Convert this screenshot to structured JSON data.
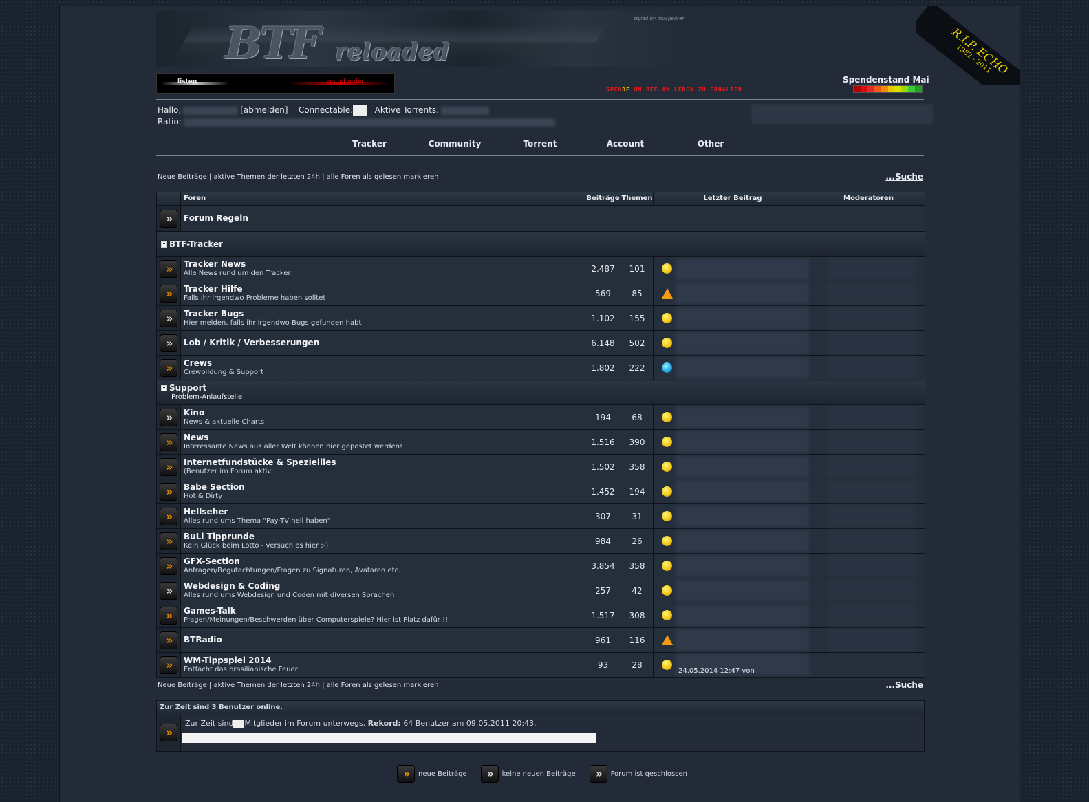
{
  "header": {
    "logo": "BTF",
    "logo_sub": "reloaded",
    "styled_by": "styled by m03pedren",
    "rip": {
      "line1": "R.I.P. ECHO",
      "line2": "1982 - 2011"
    },
    "radio": {
      "listen": "listen",
      "status": "out of order"
    },
    "spende": {
      "part1": "SPEN",
      "part2": "DE",
      "part3": " UM BTF AM LEBEN ZU ERHALTEN"
    },
    "spendenstand": "Spendenstand Mai",
    "spend_colors": [
      "#b40000",
      "#d21010",
      "#e62828",
      "#ee5a1a",
      "#f08c10",
      "#e8c800",
      "#d6e000",
      "#9ad800",
      "#3cc83c",
      "#20a020"
    ]
  },
  "user": {
    "hallo": "Hallo,",
    "abmelden": "[abmelden]",
    "connectable": "Connectable:",
    "aktive_torrents": "Aktive Torrents:",
    "ratio": "Ratio:"
  },
  "nav": [
    "Tracker",
    "Community",
    "Torrent",
    "Account",
    "Other"
  ],
  "links": {
    "neue": "Neue Beiträge",
    "sep": " | ",
    "aktive": "aktive Themen der letzten 24h",
    "alle": "alle Foren als gelesen markieren",
    "suche": "...Suche"
  },
  "table": {
    "headers": {
      "foren": "Foren",
      "beitraege": "Beiträge",
      "themen": "Themen",
      "letzter": "Letzter Beitrag",
      "mods": "Moderatoren"
    },
    "rules": "Forum Regeln",
    "cat1": "BTF-Tracker",
    "cat2": {
      "name": "Support",
      "desc": "Problem-Anlaufstelle"
    },
    "group1": [
      {
        "name": "Tracker News",
        "desc": "Alle News rund um den Tracker",
        "posts": "2.487",
        "threads": "101",
        "icon": "smile",
        "new": true
      },
      {
        "name": "Tracker Hilfe",
        "desc": "Falls ihr irgendwo Probleme haben solltet",
        "posts": "569",
        "threads": "85",
        "icon": "warn",
        "new": true
      },
      {
        "name": "Tracker Bugs",
        "desc": "Hier melden, falls ihr irgendwo Bugs gefunden habt",
        "posts": "1.102",
        "threads": "155",
        "icon": "smile",
        "new": false
      },
      {
        "name": "Lob / Kritik / Verbesserungen",
        "desc": "",
        "posts": "6.148",
        "threads": "502",
        "icon": "smile",
        "new": false
      },
      {
        "name": "Crews",
        "desc": "Crewbildung & Support",
        "posts": "1.802",
        "threads": "222",
        "icon": "q",
        "new": true
      }
    ],
    "group2": [
      {
        "name": "Kino",
        "desc": "News & aktuelle Charts",
        "posts": "194",
        "threads": "68",
        "icon": "smile",
        "new": false
      },
      {
        "name": "News",
        "desc": "Interessante News aus aller Welt können hier gepostet werden!",
        "posts": "1.516",
        "threads": "390",
        "icon": "smile",
        "new": true
      },
      {
        "name": "Internetfundstücke & Speziellles",
        "desc": "(Benutzer im Forum aktiv:",
        "posts": "1.502",
        "threads": "358",
        "icon": "smile",
        "new": true
      },
      {
        "name": "Babe Section",
        "desc": "Hot & Dirty",
        "posts": "1.452",
        "threads": "194",
        "icon": "smile",
        "new": true
      },
      {
        "name": "Hellseher",
        "desc": "Alles rund ums Thema \"Pay-TV hell haben\"",
        "posts": "307",
        "threads": "31",
        "icon": "smile",
        "new": true
      },
      {
        "name": "BuLi Tipprunde",
        "desc": "Kein Glück beim Lotto - versuch es hier ;-)",
        "posts": "984",
        "threads": "26",
        "icon": "smile",
        "new": true
      },
      {
        "name": "GFX-Section",
        "desc": "Anfragen/Begutachtungen/Fragen zu Signaturen, Avataren etc.",
        "posts": "3.854",
        "threads": "358",
        "icon": "smile",
        "new": true
      },
      {
        "name": "Webdesign & Coding",
        "desc": "Alles rund ums Webdesign und Coden mit diversen Sprachen",
        "posts": "257",
        "threads": "42",
        "icon": "smile",
        "new": false
      },
      {
        "name": "Games-Talk",
        "desc": "Fragen/Meinungen/Beschwerden über Computerspiele? Hier ist Platz dafür !!",
        "posts": "1.517",
        "threads": "308",
        "icon": "smile",
        "new": true
      },
      {
        "name": "BTRadio",
        "desc": "",
        "posts": "961",
        "threads": "116",
        "icon": "warn",
        "new": true
      },
      {
        "name": "WM-Tippspiel 2014",
        "desc": "Entfacht das brasilianische Feuer",
        "posts": "93",
        "threads": "28",
        "icon": "smile",
        "new": true,
        "last": "24.05.2014 12:47 von"
      }
    ]
  },
  "online": {
    "header": "Zur Zeit sind 3 Benutzer online.",
    "pre": "Zur Zeit sind",
    "mid": "Mitglieder im Forum unterwegs.",
    "rekord_label": "Rekord:",
    "rekord": "64 Benutzer am 09.05.2011 20:43."
  },
  "legend": {
    "neue": "neue Beiträge",
    "keine": "keine neuen Beiträge",
    "geschlossen": "Forum ist geschlossen"
  }
}
